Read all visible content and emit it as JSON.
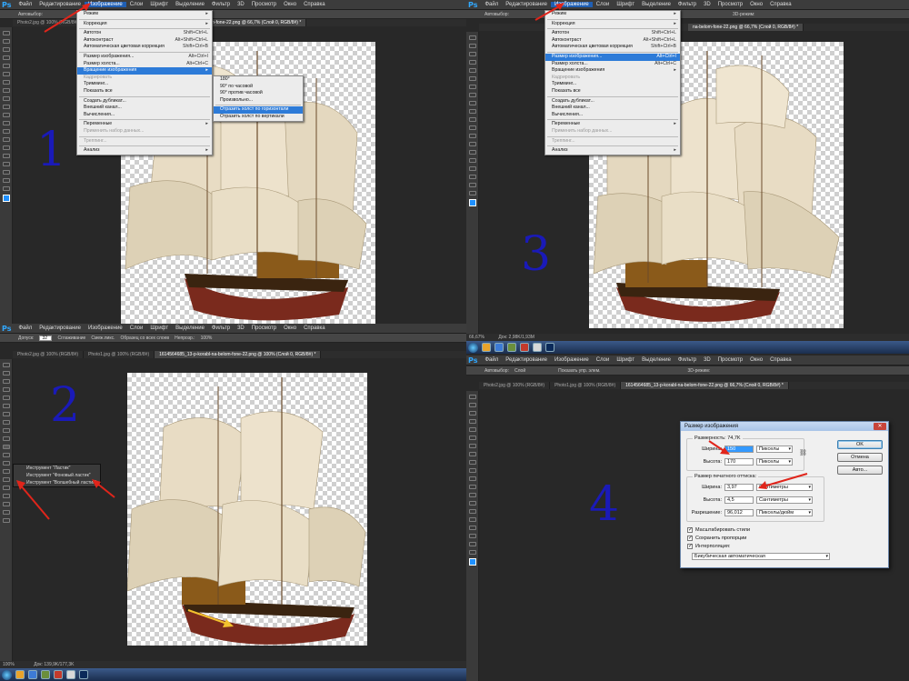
{
  "panels": {
    "panel1": {
      "menubar": [
        "Файл",
        "Редактирование",
        "Изображение",
        "Слои",
        "Шрифт",
        "Выделение",
        "Фильтр",
        "3D",
        "Просмотр",
        "Окно",
        "Справка"
      ],
      "options_text": "Автовыбор:",
      "tab": "kol-na-belom-fone-22.png @ 66,7% (Слой 0, RGB/8#) *",
      "tab_prefix": "Photo2.jpg @ 100% (RGB/8#)",
      "number": "1",
      "image_menu": [
        {
          "label": "Режим",
          "shortcut": "",
          "sub": true
        },
        {
          "sep": true
        },
        {
          "label": "Коррекция",
          "shortcut": "",
          "sub": true
        },
        {
          "sep": true
        },
        {
          "label": "Автотон",
          "shortcut": "Shift+Ctrl+L"
        },
        {
          "label": "Автоконтраст",
          "shortcut": "Alt+Shift+Ctrl+L"
        },
        {
          "label": "Автоматическая цветовая коррекция",
          "shortcut": "Shift+Ctrl+B"
        },
        {
          "sep": true
        },
        {
          "label": "Размер изображения...",
          "shortcut": "Alt+Ctrl+I"
        },
        {
          "label": "Размер холста...",
          "shortcut": "Alt+Ctrl+C"
        },
        {
          "label": "Вращение изображения",
          "shortcut": "",
          "sub": true,
          "hl": true
        },
        {
          "label": "Кадрировать",
          "shortcut": "",
          "dis": true
        },
        {
          "label": "Тримминг...",
          "shortcut": ""
        },
        {
          "label": "Показать все",
          "shortcut": ""
        },
        {
          "sep": true
        },
        {
          "label": "Создать дубликат...",
          "shortcut": ""
        },
        {
          "label": "Внешний канал...",
          "shortcut": ""
        },
        {
          "label": "Вычисления...",
          "shortcut": ""
        },
        {
          "sep": true
        },
        {
          "label": "Переменные",
          "shortcut": "",
          "sub": true
        },
        {
          "label": "Применить набор данных...",
          "shortcut": "",
          "dis": true
        },
        {
          "sep": true
        },
        {
          "label": "Треппинг...",
          "shortcut": "",
          "dis": true
        },
        {
          "sep": true
        },
        {
          "label": "Анализ",
          "shortcut": "",
          "sub": true
        }
      ],
      "rotate_submenu": [
        {
          "label": "180°"
        },
        {
          "label": "90° по часовой"
        },
        {
          "label": "90° против часовой"
        },
        {
          "label": "Произвольно..."
        },
        {
          "sep": true
        },
        {
          "label": "Отразить холст по горизонтали",
          "hl": true
        },
        {
          "label": "Отразить холст по вертикали"
        }
      ]
    },
    "panel2": {
      "menubar": [
        "Файл",
        "Редактирование",
        "Изображение",
        "Слои",
        "Шрифт",
        "Выделение",
        "Фильтр",
        "3D",
        "Просмотр",
        "Окно",
        "Справка"
      ],
      "options": [
        "Допуск:",
        "32",
        "Сглаживание",
        "Смеж.пикс.",
        "Образец со всех слоев",
        "Непрозр.:",
        "100%"
      ],
      "tabs": [
        "Photo2.jpg @ 100% (RGB/8#)",
        "Photo1.jpg @ 100% (RGB/8#)",
        "1614564685_13-p-korabl-na-belom-fone-22.png @ 100% (Слой 0, RGB/8#) *"
      ],
      "number": "2",
      "eraser_flyout": [
        "Инструмент \"Ластик\"",
        "Инструмент \"Фоновый ластик\"",
        "Инструмент \"Волшебный ластик\""
      ],
      "status": "100%",
      "status_doc": "Док: 139,9K/177,3K"
    },
    "panel3": {
      "menubar": [
        "Файл",
        "Редактирование",
        "Изображение",
        "Слои",
        "Шрифт",
        "Выделение",
        "Фильтр",
        "3D",
        "Просмотр",
        "Окно",
        "Справка"
      ],
      "options_text": "Автовыбор:",
      "tab": "na-belom-fone-22.png @ 66,7% (Слой 0, RGB/8#) *",
      "options_3d": "3D-режим:",
      "number": "3",
      "image_menu": [
        {
          "label": "Режим",
          "shortcut": "",
          "sub": true
        },
        {
          "sep": true
        },
        {
          "label": "Коррекция",
          "shortcut": "",
          "sub": true
        },
        {
          "sep": true
        },
        {
          "label": "Автотон",
          "shortcut": "Shift+Ctrl+L"
        },
        {
          "label": "Автоконтраст",
          "shortcut": "Alt+Shift+Ctrl+L"
        },
        {
          "label": "Автоматическая цветовая коррекция",
          "shortcut": "Shift+Ctrl+B"
        },
        {
          "sep": true
        },
        {
          "label": "Размер изображения...",
          "shortcut": "Alt+Ctrl+I",
          "hl": true
        },
        {
          "label": "Размер холста...",
          "shortcut": "Alt+Ctrl+C"
        },
        {
          "label": "Вращение изображения",
          "shortcut": "",
          "sub": true
        },
        {
          "label": "Кадрировать",
          "shortcut": "",
          "dis": true
        },
        {
          "label": "Тримминг...",
          "shortcut": ""
        },
        {
          "label": "Показать все",
          "shortcut": ""
        },
        {
          "sep": true
        },
        {
          "label": "Создать дубликат...",
          "shortcut": ""
        },
        {
          "label": "Внешний канал...",
          "shortcut": ""
        },
        {
          "label": "Вычисления...",
          "shortcut": ""
        },
        {
          "sep": true
        },
        {
          "label": "Переменные",
          "shortcut": "",
          "sub": true
        },
        {
          "label": "Применить набор данных...",
          "shortcut": "",
          "dis": true
        },
        {
          "sep": true
        },
        {
          "label": "Треппинг...",
          "shortcut": "",
          "dis": true
        },
        {
          "sep": true
        },
        {
          "label": "Анализ",
          "shortcut": "",
          "sub": true
        }
      ],
      "status": "66,67%",
      "status_doc": "Док: 2,98K/1,93M"
    },
    "panel4": {
      "menubar": [
        "Файл",
        "Редактирование",
        "Изображение",
        "Слои",
        "Шрифт",
        "Выделение",
        "Фильтр",
        "3D",
        "Просмотр",
        "Окно",
        "Справка"
      ],
      "options": [
        "Автовыбор:",
        "Слой",
        "Показать упр. элем."
      ],
      "options_3d": "3D-режим:",
      "tabs": [
        "Photo2.jpg @ 100% (RGB/8#)",
        "Photo1.jpg @ 100% (RGB/8#)",
        "1614564685_13-p-korabl-na-belom-fone-22.png @ 66,7% (Слой 0, RGB/8#) *"
      ],
      "number": "4",
      "dialog": {
        "title": "Размер изображения",
        "dimensions_label": "Размерность:",
        "dimensions_value": "74,7K",
        "width_label": "Ширина:",
        "width_value": "150",
        "width_unit": "Пикселы",
        "height_label": "Высота:",
        "height_value": "170",
        "height_unit": "Пикселы",
        "print_label": "Размер печатного оттиска:",
        "pwidth_label": "Ширина:",
        "pwidth_value": "3,97",
        "pwidth_unit": "Сантиметры",
        "pheight_label": "Высота:",
        "pheight_value": "4,5",
        "pheight_unit": "Сантиметры",
        "res_label": "Разрешение:",
        "res_value": "96,012",
        "res_unit": "Пикселы/дюйм",
        "scale_styles": "Масштабировать стили",
        "constrain": "Сохранить пропорции",
        "interp": "Интерполяция:",
        "interp_value": "Бикубическая автоматическая",
        "ok": "OK",
        "cancel": "Отмена",
        "auto": "Авто..."
      }
    }
  },
  "colors": {
    "ps_bg": "#282828",
    "ps_bar": "#3c3c3c",
    "menu_hl": "#2d7bd8",
    "number": "#1a1ab8",
    "arrow": "#e0251b",
    "arrow_yellow": "#f2c12e"
  }
}
